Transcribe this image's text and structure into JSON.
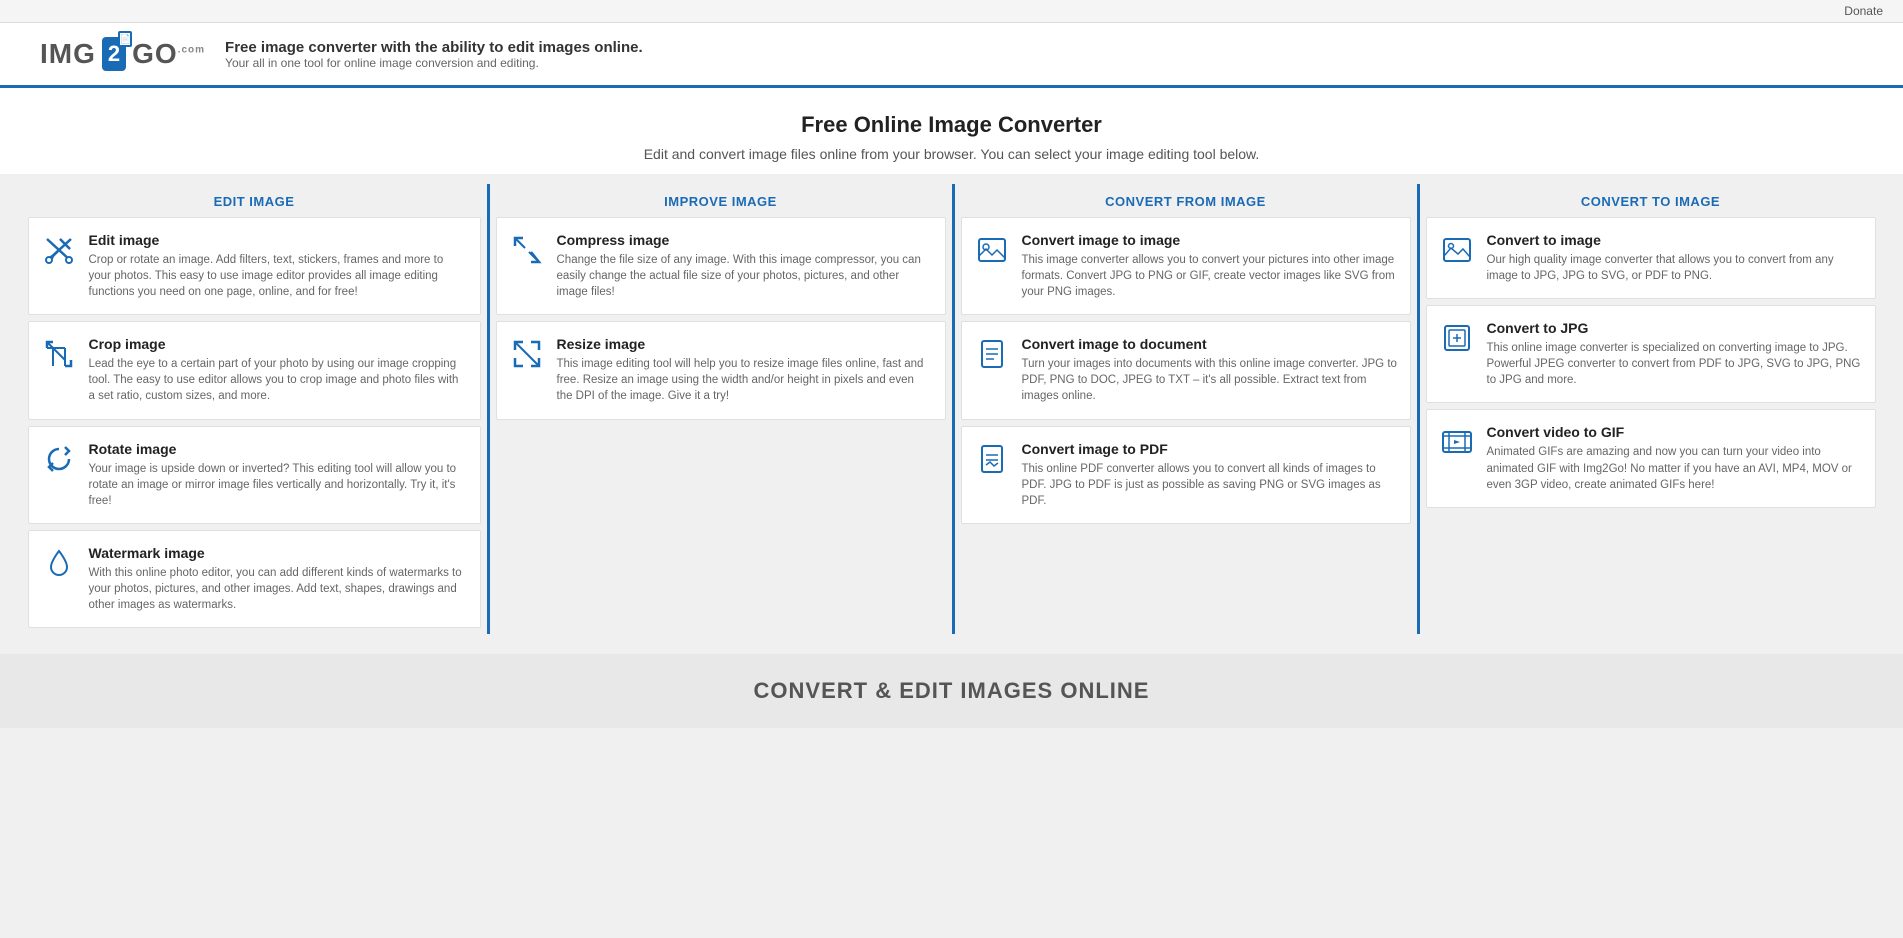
{
  "topbar": {
    "donate_label": "Donate"
  },
  "header": {
    "logo_img_text": "IMG",
    "logo_2": "2",
    "logo_go": "GO",
    "logo_com": ".com",
    "tagline_main": "Free image converter with the ability to edit images online.",
    "tagline_sub": "Your all in one tool for online image conversion and editing."
  },
  "hero": {
    "title": "Free Online Image Converter",
    "subtitle": "Edit and convert image files online from your browser. You can select your image editing tool below."
  },
  "columns": [
    {
      "header": "EDIT IMAGE",
      "tools": [
        {
          "name": "Edit image",
          "icon": "edit",
          "description": "Crop or rotate an image. Add filters, text, stickers, frames and more to your photos. This easy to use image editor provides all image editing functions you need on one page, online, and for free!"
        },
        {
          "name": "Crop image",
          "icon": "crop",
          "description": "Lead the eye to a certain part of your photo by using our image cropping tool. The easy to use editor allows you to crop image and photo files with a set ratio, custom sizes, and more."
        },
        {
          "name": "Rotate image",
          "icon": "rotate",
          "description": "Your image is upside down or inverted? This editing tool will allow you to rotate an image or mirror image files vertically and horizontally. Try it, it's free!"
        },
        {
          "name": "Watermark image",
          "icon": "watermark",
          "description": "With this online photo editor, you can add different kinds of watermarks to your photos, pictures, and other images. Add text, shapes, drawings and other images as watermarks."
        }
      ]
    },
    {
      "header": "IMPROVE IMAGE",
      "tools": [
        {
          "name": "Compress image",
          "icon": "compress",
          "description": "Change the file size of any image. With this image compressor, you can easily change the actual file size of your photos, pictures, and other image files!"
        },
        {
          "name": "Resize image",
          "icon": "resize",
          "description": "This image editing tool will help you to resize image files online, fast and free. Resize an image using the width and/or height in pixels and even the DPI of the image. Give it a try!"
        }
      ]
    },
    {
      "header": "CONVERT FROM IMAGE",
      "tools": [
        {
          "name": "Convert image to image",
          "icon": "convert-image",
          "description": "This image converter allows you to convert your pictures into other image formats. Convert JPG to PNG or GIF, create vector images like SVG from your PNG images."
        },
        {
          "name": "Convert image to document",
          "icon": "convert-doc",
          "description": "Turn your images into documents with this online image converter. JPG to PDF, PNG to DOC, JPEG to TXT – it's all possible. Extract text from images online."
        },
        {
          "name": "Convert image to PDF",
          "icon": "convert-pdf",
          "description": "This online PDF converter allows you to convert all kinds of images to PDF. JPG to PDF is just as possible as saving PNG or SVG images as PDF."
        }
      ]
    },
    {
      "header": "CONVERT TO IMAGE",
      "tools": [
        {
          "name": "Convert to image",
          "icon": "to-image",
          "description": "Our high quality image converter that allows you to convert from any image to JPG, JPG to SVG, or PDF to PNG."
        },
        {
          "name": "Convert to JPG",
          "icon": "to-jpg",
          "description": "This online image converter is specialized on converting image to JPG. Powerful JPEG converter to convert from PDF to JPG, SVG to JPG, PNG to JPG and more."
        },
        {
          "name": "Convert video to GIF",
          "icon": "to-gif",
          "description": "Animated GIFs are amazing and now you can turn your video into animated GIF with Img2Go! No matter if you have an AVI, MP4, MOV or even 3GP video, create animated GIFs here!"
        }
      ]
    }
  ],
  "bottom_banner": {
    "text": "CONVERT & EDIT IMAGES ONLINE"
  }
}
